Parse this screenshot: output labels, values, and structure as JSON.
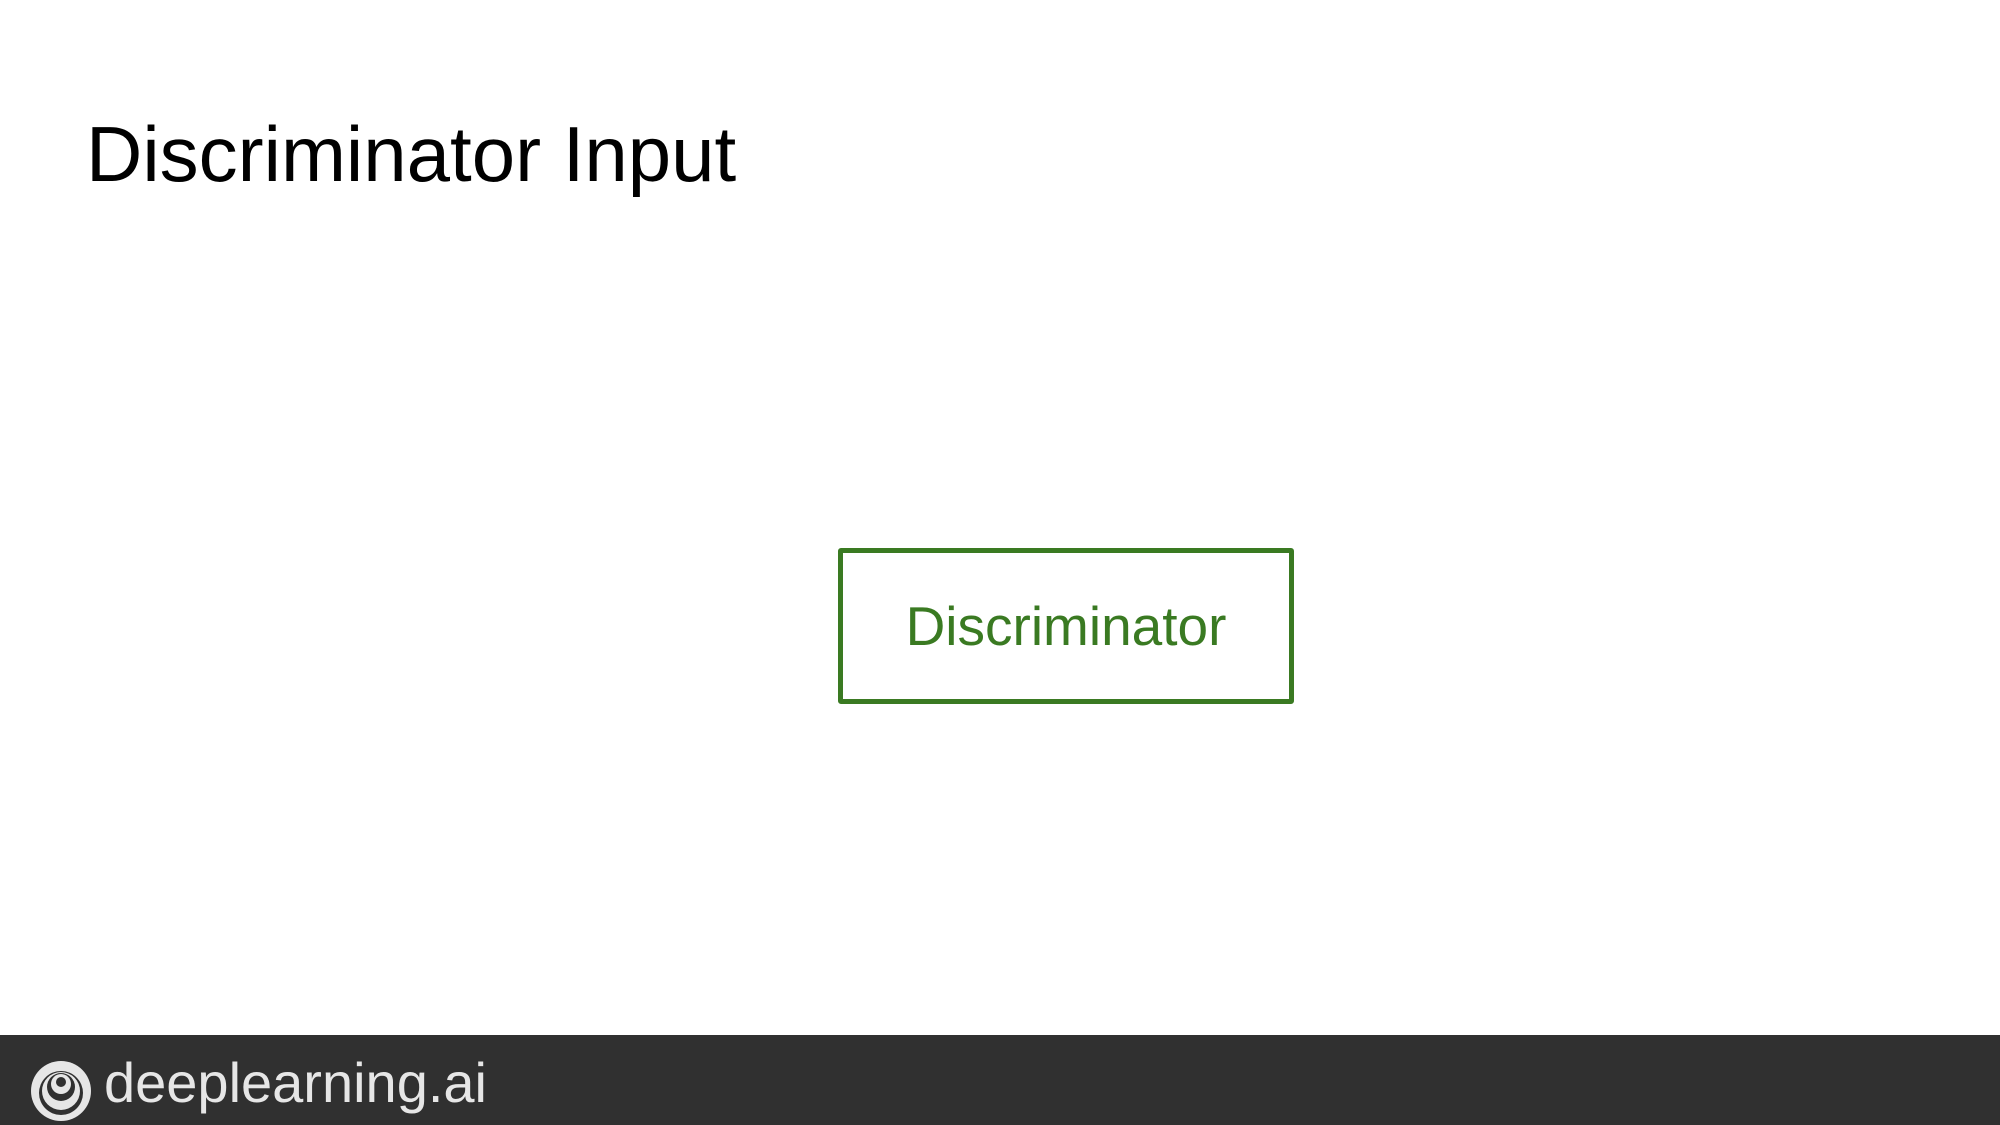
{
  "slide": {
    "title": "Discriminator Input"
  },
  "diagram": {
    "discriminator_label": "Discriminator",
    "box_color": "#3a7a22"
  },
  "footer": {
    "brand_text": "deeplearning.ai",
    "logo_icon": "deeplearning-logo-icon",
    "background_color": "#303030"
  }
}
